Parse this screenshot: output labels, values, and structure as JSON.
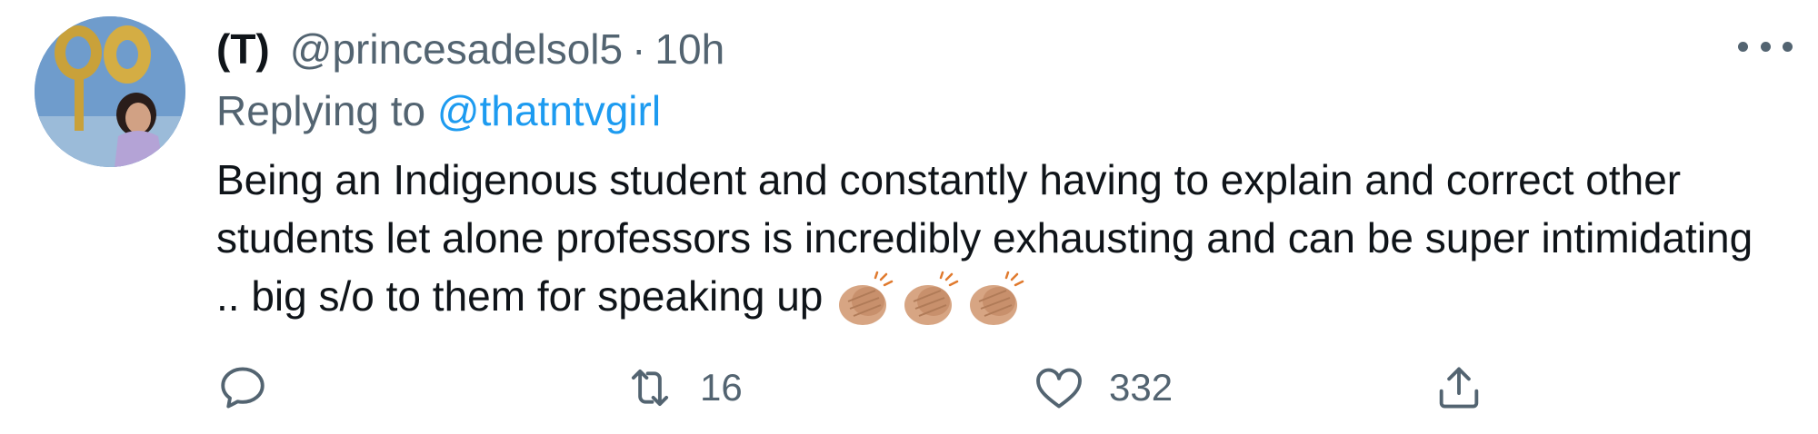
{
  "tweet": {
    "display_name": "(T)",
    "handle": "@princesadelsol5",
    "separator": "·",
    "time": "10h",
    "replying_prefix": "Replying to",
    "replying_handle": "@thatntvgirl",
    "text": "Being an Indigenous student and constantly having to explain and correct other students let alone professors is incredibly exhausting and can be super intimidating .. big s/o to them for speaking up",
    "emoji": "clapping-hands-medium-light-skin-tone x3"
  },
  "actions": {
    "reply_icon": "reply-bubble-icon",
    "retweet_icon": "retweet-icon",
    "retweet_count": "16",
    "like_icon": "heart-icon",
    "like_count": "332",
    "share_icon": "share-icon"
  },
  "colors": {
    "text_primary": "#0f1419",
    "text_secondary": "#536471",
    "link": "#1d9bf0",
    "background": "#ffffff"
  }
}
